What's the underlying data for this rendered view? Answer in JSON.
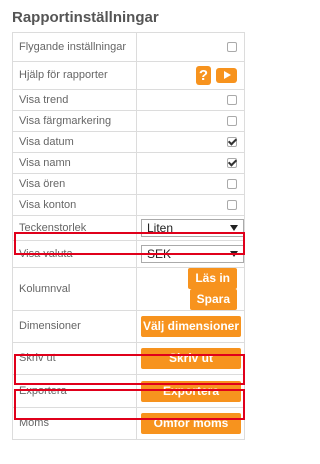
{
  "title": "Rapportinställningar",
  "rows": {
    "flygande": {
      "label": "Flygande inställningar",
      "checked": false
    },
    "hjalp": {
      "label": "Hjälp för rapporter"
    },
    "trend": {
      "label": "Visa trend",
      "checked": false
    },
    "fargmarkering": {
      "label": "Visa färgmarkering",
      "checked": false
    },
    "datum": {
      "label": "Visa datum",
      "checked": true
    },
    "namn": {
      "label": "Visa namn",
      "checked": true
    },
    "oren": {
      "label": "Visa ören",
      "checked": false
    },
    "konton": {
      "label": "Visa konton",
      "checked": false
    },
    "teckenstorlek": {
      "label": "Teckenstorlek",
      "value": "Liten"
    },
    "valuta": {
      "label": "Visa valuta",
      "value": "SEK"
    },
    "kolumnval": {
      "label": "Kolumnval",
      "load_label": "Läs in",
      "save_label": "Spara"
    },
    "dimensioner": {
      "label": "Dimensioner",
      "button_label": "Välj dimensioner"
    },
    "skrivut": {
      "label": "Skriv ut",
      "button_label": "Skriv ut"
    },
    "exportera": {
      "label": "Exportera",
      "button_label": "Exportera"
    },
    "moms": {
      "label": "Moms",
      "button_label": "Omför moms"
    }
  },
  "icons": {
    "help": "help-question-icon",
    "video": "video-play-icon"
  },
  "colors": {
    "accent": "#f7931e",
    "highlight": "#e0001b"
  }
}
